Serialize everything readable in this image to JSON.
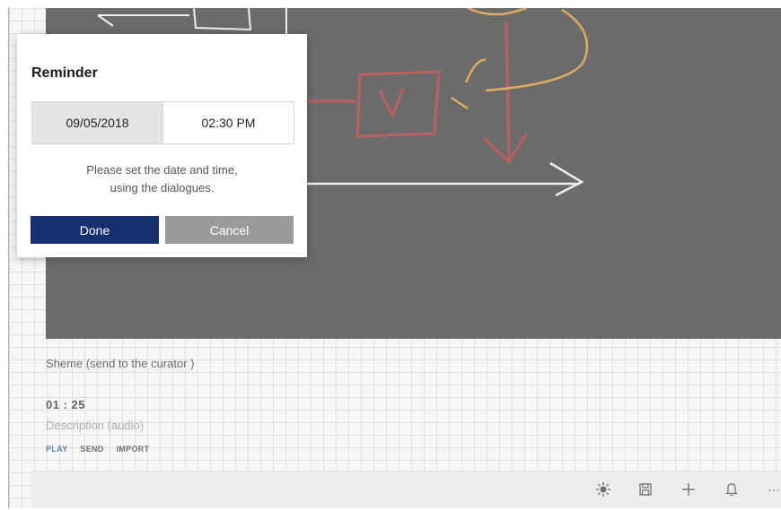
{
  "scheme": {
    "title": "Sheme (send to the curator )",
    "timer": "01 : 25",
    "description": "Description (audio)",
    "actions": [
      "PLAY",
      "SEND",
      "IMPORT"
    ]
  },
  "toolbar": {
    "icons": [
      "sun-icon",
      "save-icon",
      "plus-icon",
      "bell-icon",
      "more-icon"
    ],
    "more_glyph": "···"
  },
  "dialog": {
    "title": "Reminder",
    "date": "09/05/2018",
    "time": "02:30 PM",
    "hint_line1": "Please set the date and time,",
    "hint_line2": "using the dialogues.",
    "done_label": "Done",
    "cancel_label": "Cancel"
  },
  "colors": {
    "canvas_bg": "#2c2c2c",
    "stroke_white": "#e8e8e8",
    "stroke_red": "#9e1c1c",
    "stroke_orange": "#d08a1a",
    "done_button": "#16306f",
    "cancel_button": "#9a9a9a"
  }
}
